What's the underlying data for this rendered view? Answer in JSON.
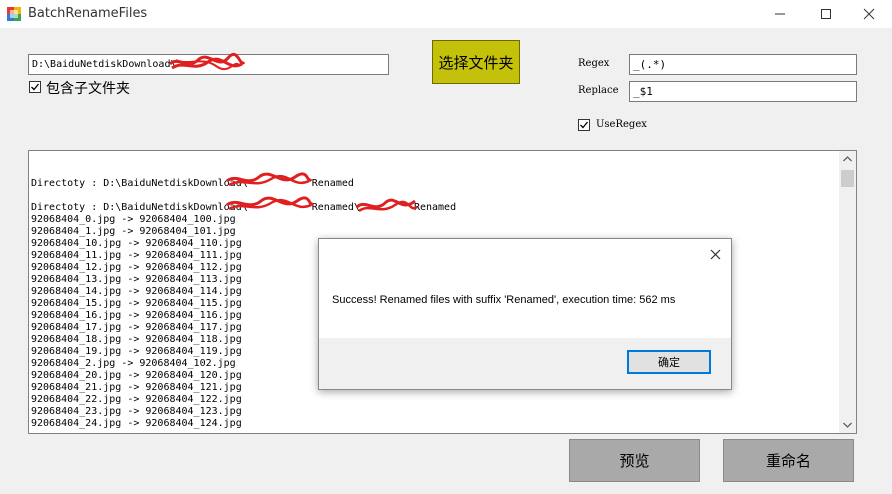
{
  "window": {
    "title": "BatchRenameFiles",
    "icons": [
      "app-icon",
      "minimize-icon",
      "maximize-icon",
      "close-icon"
    ]
  },
  "folder": {
    "path_value": "D:\\BaiduNetdiskDownload\\",
    "include_subfolders_label": "包含子文件夹",
    "include_subfolders_checked": true,
    "select_button_label": "选择文件夹",
    "select_button_color": "#c4c10a"
  },
  "regex_panel": {
    "regex_label": "Regex",
    "regex_value": "_(.*)",
    "replace_label": "Replace",
    "replace_value": "_$1",
    "use_regex_label": "UseRegex",
    "use_regex_checked": true
  },
  "log": {
    "lines": [
      "Directoty : D:\\BaiduNetdiskDownload\\",
      "Directoty : D:\\BaiduNetdiskDownload\\",
      "92068404_0.jpg -> 92068404_100.jpg",
      "92068404_1.jpg -> 92068404_101.jpg",
      "92068404_10.jpg -> 92068404_110.jpg",
      "92068404_11.jpg -> 92068404_111.jpg",
      "92068404_12.jpg -> 92068404_112.jpg",
      "92068404_13.jpg -> 92068404_113.jpg",
      "92068404_14.jpg -> 92068404_114.jpg",
      "92068404_15.jpg -> 92068404_115.jpg",
      "92068404_16.jpg -> 92068404_116.jpg",
      "92068404_17.jpg -> 92068404_117.jpg",
      "92068404_18.jpg -> 92068404_118.jpg",
      "92068404_19.jpg -> 92068404_119.jpg",
      "92068404_2.jpg -> 92068404_102.jpg",
      "92068404_20.jpg -> 92068404_120.jpg",
      "92068404_21.jpg -> 92068404_121.jpg",
      "92068404_22.jpg -> 92068404_122.jpg",
      "92068404_23.jpg -> 92068404_123.jpg",
      "92068404_24.jpg -> 92068404_124.jpg"
    ],
    "dir_suffix_1": "Renamed",
    "dir_suffix_2a": "Renamed\\",
    "dir_suffix_2b": "-Renamed"
  },
  "actions": {
    "preview_label": "预览",
    "rename_label": "重命名"
  },
  "dialog": {
    "message": "Success! Renamed files with suffix 'Renamed', execution time: 562 ms",
    "ok_label": "确定"
  }
}
